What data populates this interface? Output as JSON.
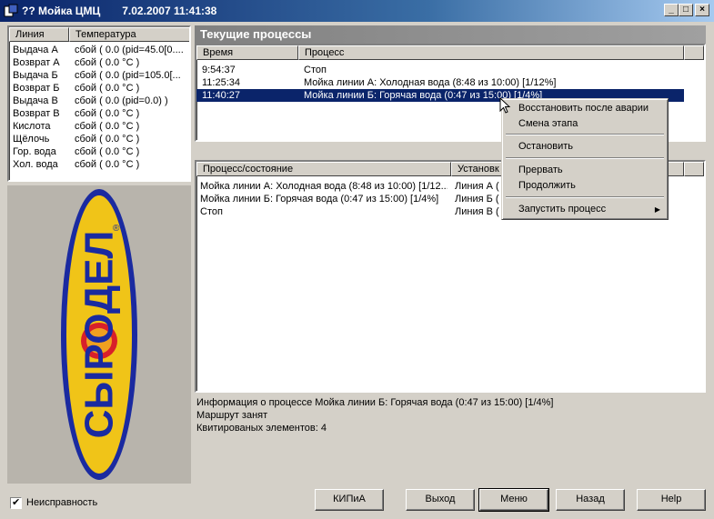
{
  "window": {
    "title": "?? Мойка ЦМЦ",
    "datetime": "7.02.2007  11:41:38",
    "minimize_label": "_",
    "maximize_label": "□",
    "close_label": "×"
  },
  "lines_table": {
    "headers": [
      "Линия",
      "Температура"
    ],
    "rows": [
      {
        "line": "Выдача А",
        "temp": "сбой ( 0.0 (pid=45.0[0...."
      },
      {
        "line": "Возврат А",
        "temp": "сбой ( 0.0 °С )"
      },
      {
        "line": "Выдача Б",
        "temp": "сбой ( 0.0 (pid=105.0[..."
      },
      {
        "line": "Возврат Б",
        "temp": "сбой ( 0.0 °С )"
      },
      {
        "line": "Выдача В",
        "temp": "сбой ( 0.0 (pid=0.0) )"
      },
      {
        "line": "Возврат В",
        "temp": "сбой ( 0.0 °С )"
      },
      {
        "line": "Кислота",
        "temp": "сбой ( 0.0 °С )"
      },
      {
        "line": "Щёлочь",
        "temp": "сбой ( 0.0 °С )"
      },
      {
        "line": "Гор. вода",
        "temp": "сбой ( 0.0 °С )"
      },
      {
        "line": "Хол. вода",
        "temp": "сбой ( 0.0 °С )"
      }
    ]
  },
  "logo": {
    "text": "СЫРОДЕЛ",
    "mark": "®"
  },
  "current_processes": {
    "title": "Текущие процессы",
    "headers": [
      "Время",
      "Процесс"
    ],
    "rows": [
      {
        "time": "9:54:37",
        "process": "Стоп"
      },
      {
        "time": "11:25:34",
        "process": "Мойка линии А: Холодная вода (8:48 из 10:00) [1/12%]"
      },
      {
        "time": "11:40:27",
        "process": "Мойка линии Б: Горячая вода (0:47 из 15:00) [1/4%]"
      }
    ],
    "selected_index": 2
  },
  "states_table": {
    "headers": [
      "Процесс/состояние",
      "Установк"
    ],
    "rows": [
      {
        "state": "Мойка линии А: Холодная вода (8:48 из 10:00) [1/12...",
        "installation": "Линия А ("
      },
      {
        "state": "Мойка линии Б: Горячая вода (0:47 из 15:00) [1/4%]",
        "installation": "Линия Б ("
      },
      {
        "state": "Стоп",
        "installation": "Линия В ("
      }
    ]
  },
  "context_menu": {
    "items": [
      "Восстановить после аварии",
      "Смена этапа",
      "Остановить",
      "Прервать",
      "Продолжить",
      "Запустить процесс"
    ],
    "submenu_arrow": "▶"
  },
  "info": {
    "line1": "Информация о процессе Мойка линии Б: Горячая вода (0:47 из 15:00) [1/4%]",
    "line2": "Маршрут занят",
    "line3": "Квитированых элементов: 4"
  },
  "fault": {
    "label": "Неисправность",
    "checked": true,
    "check_mark": "✔"
  },
  "buttons": {
    "kipia": "КИПиА",
    "exit": "Выход",
    "menu": "Меню",
    "back": "Назад",
    "help": "Help"
  },
  "colors": {
    "title_bar": "#0a246a",
    "selection": "#0a246a",
    "logo_yellow": "#f0c418",
    "logo_blue": "#1a2aa0",
    "logo_red": "#d8202a"
  }
}
